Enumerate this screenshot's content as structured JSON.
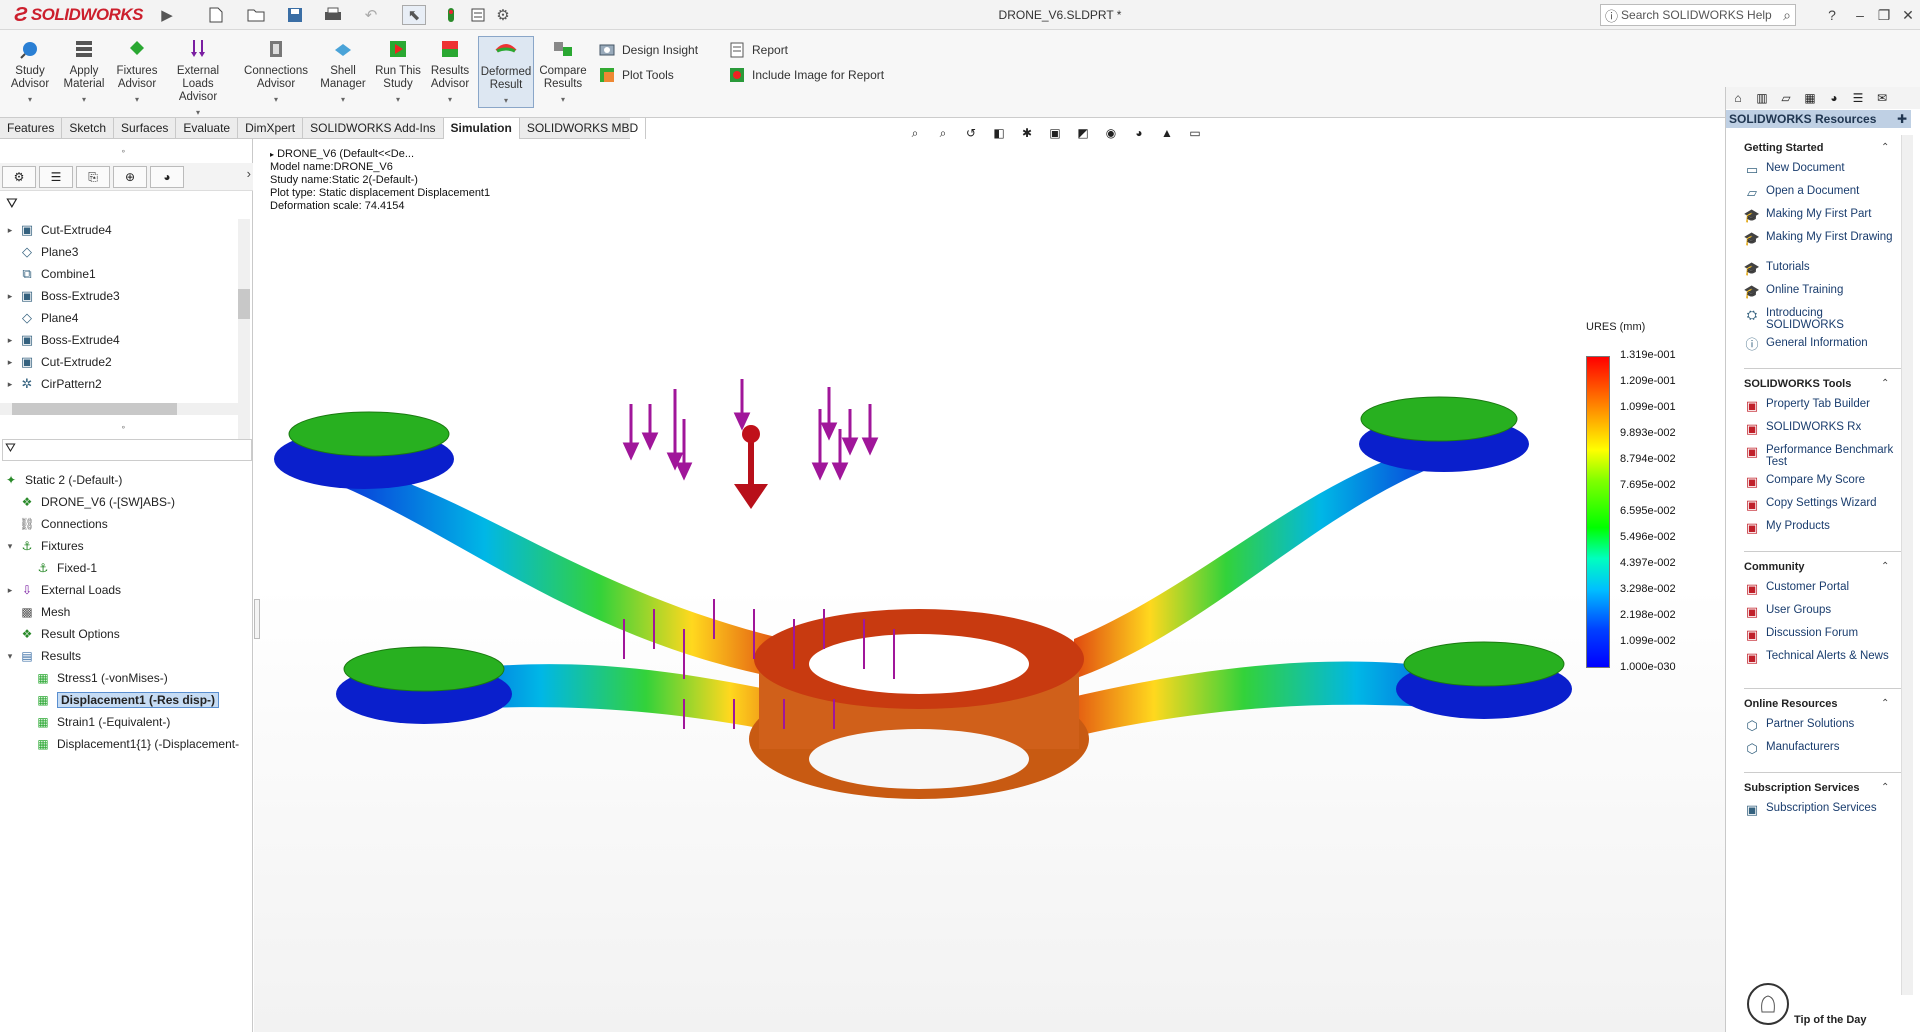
{
  "app": {
    "logo": "SOLIDWORKS",
    "document_title": "DRONE_V6.SLDPRT *"
  },
  "search": {
    "placeholder": "Search SOLIDWORKS Help"
  },
  "ribbon": {
    "large": [
      {
        "id": "study-advisor",
        "label": "Study\nAdvisor",
        "icon": "study-icon"
      },
      {
        "id": "apply-material",
        "label": "Apply\nMaterial",
        "icon": "material-icon"
      },
      {
        "id": "fixtures-advisor",
        "label": "Fixtures\nAdvisor",
        "icon": "fixture-icon"
      },
      {
        "id": "external-loads-advisor",
        "label": "External Loads\nAdvisor",
        "icon": "load-icon"
      },
      {
        "id": "connections-advisor",
        "label": "Connections\nAdvisor",
        "icon": "connection-icon"
      },
      {
        "id": "shell-manager",
        "label": "Shell\nManager",
        "icon": "shell-icon"
      },
      {
        "id": "run-this-study",
        "label": "Run This\nStudy",
        "icon": "run-icon"
      },
      {
        "id": "results-advisor",
        "label": "Results\nAdvisor",
        "icon": "results-icon"
      },
      {
        "id": "deformed-result",
        "label": "Deformed\nResult",
        "icon": "deformed-icon"
      },
      {
        "id": "compare-results",
        "label": "Compare\nResults",
        "icon": "compare-icon"
      }
    ],
    "small": {
      "design_insight": "Design Insight",
      "plot_tools": "Plot Tools",
      "report": "Report",
      "include_image": "Include Image for Report"
    }
  },
  "tabs": [
    "Features",
    "Sketch",
    "Surfaces",
    "Evaluate",
    "DimXpert",
    "SOLIDWORKS Add-Ins",
    "Simulation",
    "SOLIDWORKS MBD"
  ],
  "active_tab": "Simulation",
  "feature_tree": [
    "Cut-Extrude4",
    "Plane3",
    "Combine1",
    "Boss-Extrude3",
    "Plane4",
    "Boss-Extrude4",
    "Cut-Extrude2",
    "CirPattern2"
  ],
  "sim_tree": {
    "study": "Static 2 (-Default-)",
    "items": [
      {
        "label": "DRONE_V6 (-[SW]ABS-)",
        "indent": 1,
        "exp": ""
      },
      {
        "label": "Connections",
        "indent": 1,
        "exp": ""
      },
      {
        "label": "Fixtures",
        "indent": 1,
        "exp": "▾"
      },
      {
        "label": "Fixed-1",
        "indent": 2,
        "exp": ""
      },
      {
        "label": "External Loads",
        "indent": 1,
        "exp": "▸"
      },
      {
        "label": "Mesh",
        "indent": 1,
        "exp": ""
      },
      {
        "label": "Result Options",
        "indent": 1,
        "exp": ""
      },
      {
        "label": "Results",
        "indent": 1,
        "exp": "▾"
      },
      {
        "label": "Stress1 (-vonMises-)",
        "indent": 2,
        "exp": ""
      },
      {
        "label": "Displacement1 (-Res disp-)",
        "indent": 2,
        "exp": "",
        "selected": true
      },
      {
        "label": "Strain1 (-Equivalent-)",
        "indent": 2,
        "exp": ""
      },
      {
        "label": "Displacement1{1} (-Displacement-",
        "indent": 2,
        "exp": ""
      }
    ]
  },
  "viewport": {
    "breadcrumb": "DRONE_V6 (Default<<De...",
    "info": [
      "Model name:DRONE_V6",
      "Study name:Static 2(-Default-)",
      "Plot type: Static displacement Displacement1",
      "Deformation scale: 74.4154"
    ]
  },
  "legend": {
    "title": "URES (mm)",
    "labels": [
      "1.319e-001",
      "1.209e-001",
      "1.099e-001",
      "9.893e-002",
      "8.794e-002",
      "7.695e-002",
      "6.595e-002",
      "5.496e-002",
      "4.397e-002",
      "3.298e-002",
      "2.198e-002",
      "1.099e-002",
      "1.000e-030"
    ]
  },
  "resources": {
    "header": "SOLIDWORKS Resources",
    "sections": [
      {
        "title": "Getting Started",
        "items": [
          "New Document",
          "Open a Document",
          "Making My First Part",
          "Making My First Drawing",
          "Tutorials",
          "Online Training",
          "Introducing SOLIDWORKS",
          "General Information"
        ]
      },
      {
        "title": "SOLIDWORKS Tools",
        "items": [
          "Property Tab Builder",
          "SOLIDWORKS Rx",
          "Performance Benchmark Test",
          "Compare My Score",
          "Copy Settings Wizard",
          "My Products"
        ]
      },
      {
        "title": "Community",
        "items": [
          "Customer Portal",
          "User Groups",
          "Discussion Forum",
          "Technical Alerts & News"
        ]
      },
      {
        "title": "Online Resources",
        "items": [
          "Partner Solutions",
          "Manufacturers"
        ]
      },
      {
        "title": "Subscription Services",
        "items": [
          "Subscription Services"
        ]
      }
    ],
    "tip": "Tip of the Day"
  },
  "colors": {
    "accent": "#cc1f2d",
    "selection": "#c6dcf4",
    "link": "#1a3d6e"
  }
}
